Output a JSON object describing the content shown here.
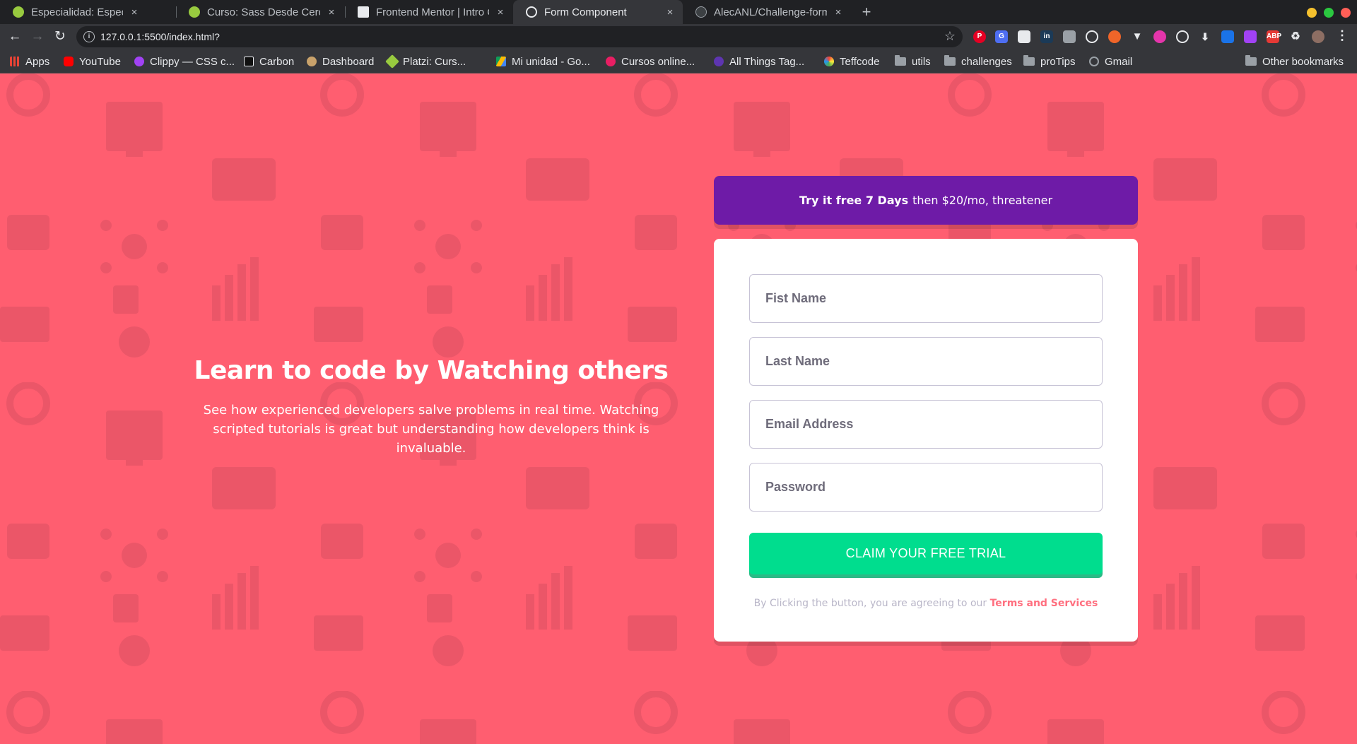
{
  "browser": {
    "tabs": [
      {
        "title": "Especialidad: Especialidad",
        "favicon": "platzi-icon"
      },
      {
        "title": "Curso: Sass Desde Cero | Edteam",
        "favicon": "platzi-icon"
      },
      {
        "title": "Frontend Mentor | Intro Component",
        "favicon": "frontend-mentor-icon"
      },
      {
        "title": "Form Component",
        "favicon": "globe-icon"
      },
      {
        "title": "AlecANL/Challenge-form-component",
        "favicon": "github-icon"
      }
    ],
    "active_tab": 3,
    "close_symbol": "×",
    "new_tab_symbol": "+",
    "url": "127.0.0.1:5500/index.html?",
    "bookmarks": [
      {
        "label": "Apps",
        "icon": "apps-grid-icon"
      },
      {
        "label": "YouTube",
        "icon": "youtube-icon"
      },
      {
        "label": "Clippy — CSS c...",
        "icon": "clippy-icon"
      },
      {
        "label": "Carbon",
        "icon": "carbon-icon"
      },
      {
        "label": "Dashboard",
        "icon": "dashboard-icon"
      },
      {
        "label": "Platzi: Curs...",
        "icon": "platzi-icon"
      },
      {
        "label": "Mi unidad - Go...",
        "icon": "google-drive-icon"
      },
      {
        "label": "Cursos online...",
        "icon": "cursos-icon"
      },
      {
        "label": "All Things Tag...",
        "icon": "tag-icon"
      },
      {
        "label": "Teffcode",
        "icon": "teffcode-icon"
      },
      {
        "label": "utils",
        "icon": "folder-icon"
      },
      {
        "label": "challenges",
        "icon": "folder-icon"
      },
      {
        "label": "proTips",
        "icon": "folder-icon"
      },
      {
        "label": "Gmail",
        "icon": "globe-icon"
      }
    ],
    "other_bookmarks": "Other bookmarks"
  },
  "hero": {
    "title": "Learn to code by Watching others",
    "description": "See how experienced developers salve problems in real time. Watching scripted tutorials is great but understanding how developers think is invaluable."
  },
  "promo": {
    "bold": "Try it free 7 Days",
    "rest": "then $20/mo, threatener"
  },
  "form": {
    "first_name_placeholder": "Fist Name",
    "last_name_placeholder": "Last Name",
    "email_placeholder": "Email Address",
    "password_placeholder": "Password",
    "submit_label": "CLAIM YOUR FREE TRIAL",
    "terms_text": "By Clicking the button, you are agreeing to our",
    "terms_link": "Terms and Services"
  },
  "colors": {
    "page_bg": "#ff5e70",
    "promo_bg": "#6e1ba7",
    "button_bg": "#00dd8e",
    "terms_link": "#ff6f7f"
  }
}
